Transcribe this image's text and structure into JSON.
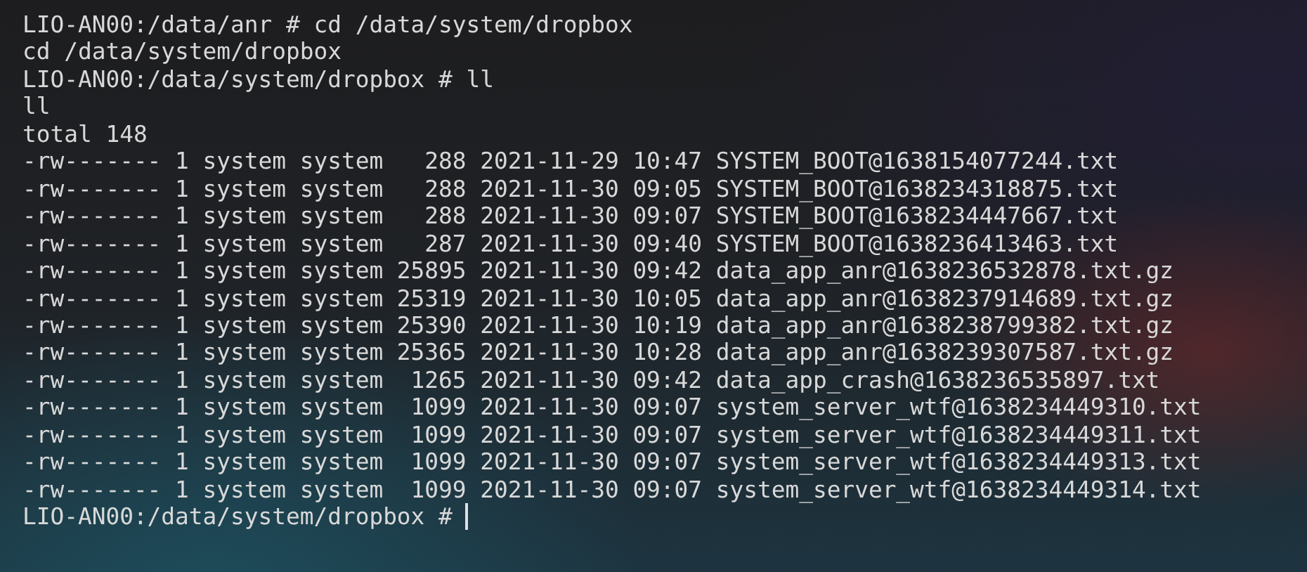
{
  "terminal": {
    "lines": [
      "LIO-AN00:/data/anr # cd /data/system/dropbox",
      "cd /data/system/dropbox",
      "LIO-AN00:/data/system/dropbox # ll",
      "ll",
      "total 148",
      "-rw------- 1 system system   288 2021-11-29 10:47 SYSTEM_BOOT@1638154077244.txt",
      "-rw------- 1 system system   288 2021-11-30 09:05 SYSTEM_BOOT@1638234318875.txt",
      "-rw------- 1 system system   288 2021-11-30 09:07 SYSTEM_BOOT@1638234447667.txt",
      "-rw------- 1 system system   287 2021-11-30 09:40 SYSTEM_BOOT@1638236413463.txt",
      "-rw------- 1 system system 25895 2021-11-30 09:42 data_app_anr@1638236532878.txt.gz",
      "-rw------- 1 system system 25319 2021-11-30 10:05 data_app_anr@1638237914689.txt.gz",
      "-rw------- 1 system system 25390 2021-11-30 10:19 data_app_anr@1638238799382.txt.gz",
      "-rw------- 1 system system 25365 2021-11-30 10:28 data_app_anr@1638239307587.txt.gz",
      "-rw------- 1 system system  1265 2021-11-30 09:42 data_app_crash@1638236535897.txt",
      "-rw------- 1 system system  1099 2021-11-30 09:07 system_server_wtf@1638234449310.txt",
      "-rw------- 1 system system  1099 2021-11-30 09:07 system_server_wtf@1638234449311.txt",
      "-rw------- 1 system system  1099 2021-11-30 09:07 system_server_wtf@1638234449313.txt",
      "-rw------- 1 system system  1099 2021-11-30 09:07 system_server_wtf@1638234449314.txt"
    ],
    "prompt": "LIO-AN00:/data/system/dropbox #"
  }
}
